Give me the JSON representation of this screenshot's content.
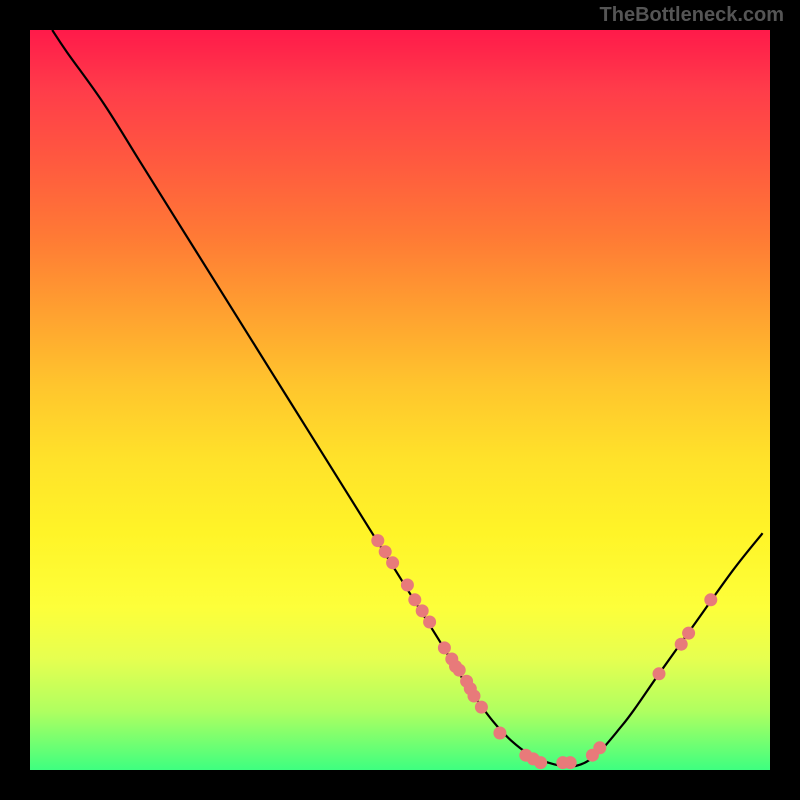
{
  "watermark": "TheBottleneck.com",
  "chart_data": {
    "type": "line",
    "title": "",
    "xlabel": "",
    "ylabel": "",
    "xlim": [
      0,
      100
    ],
    "ylim": [
      0,
      100
    ],
    "curve": [
      {
        "x": 3,
        "y": 100
      },
      {
        "x": 5,
        "y": 97
      },
      {
        "x": 10,
        "y": 90
      },
      {
        "x": 15,
        "y": 82
      },
      {
        "x": 20,
        "y": 74
      },
      {
        "x": 25,
        "y": 66
      },
      {
        "x": 30,
        "y": 58
      },
      {
        "x": 35,
        "y": 50
      },
      {
        "x": 40,
        "y": 42
      },
      {
        "x": 45,
        "y": 34
      },
      {
        "x": 50,
        "y": 26
      },
      {
        "x": 55,
        "y": 18
      },
      {
        "x": 60,
        "y": 10
      },
      {
        "x": 65,
        "y": 4
      },
      {
        "x": 70,
        "y": 1
      },
      {
        "x": 75,
        "y": 1
      },
      {
        "x": 80,
        "y": 6
      },
      {
        "x": 85,
        "y": 13
      },
      {
        "x": 90,
        "y": 20
      },
      {
        "x": 95,
        "y": 27
      },
      {
        "x": 99,
        "y": 32
      }
    ],
    "data_points": [
      {
        "x": 47,
        "y": 31
      },
      {
        "x": 48,
        "y": 29.5
      },
      {
        "x": 49,
        "y": 28
      },
      {
        "x": 51,
        "y": 25
      },
      {
        "x": 52,
        "y": 23
      },
      {
        "x": 53,
        "y": 21.5
      },
      {
        "x": 54,
        "y": 20
      },
      {
        "x": 56,
        "y": 16.5
      },
      {
        "x": 57,
        "y": 15
      },
      {
        "x": 57.5,
        "y": 14
      },
      {
        "x": 58,
        "y": 13.5
      },
      {
        "x": 59,
        "y": 12
      },
      {
        "x": 59.5,
        "y": 11
      },
      {
        "x": 60,
        "y": 10
      },
      {
        "x": 61,
        "y": 8.5
      },
      {
        "x": 63.5,
        "y": 5
      },
      {
        "x": 67,
        "y": 2
      },
      {
        "x": 68,
        "y": 1.5
      },
      {
        "x": 69,
        "y": 1
      },
      {
        "x": 72,
        "y": 1
      },
      {
        "x": 73,
        "y": 1
      },
      {
        "x": 76,
        "y": 2
      },
      {
        "x": 77,
        "y": 3
      },
      {
        "x": 85,
        "y": 13
      },
      {
        "x": 88,
        "y": 17
      },
      {
        "x": 89,
        "y": 18.5
      },
      {
        "x": 92,
        "y": 23
      }
    ],
    "background": "gradient-red-to-green",
    "note": "Valley curve with scatter points along the curve; minimum near x≈72"
  }
}
